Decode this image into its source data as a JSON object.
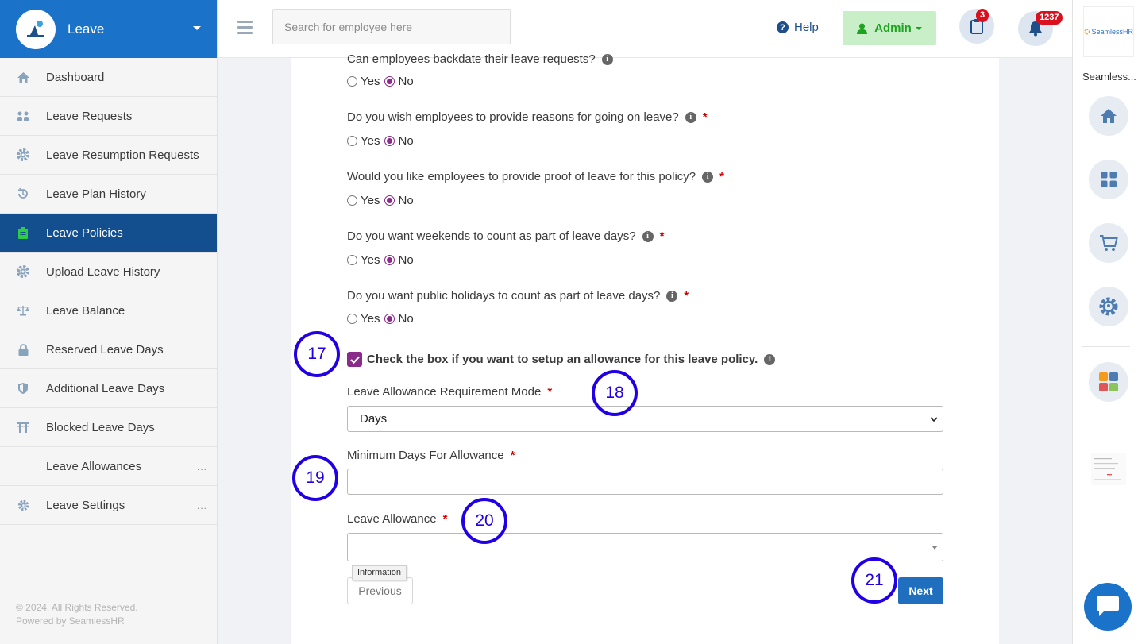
{
  "sidebar": {
    "title": "Leave",
    "items": [
      {
        "label": "Dashboard",
        "icon": "home-icon"
      },
      {
        "label": "Leave Requests",
        "icon": "users-icon"
      },
      {
        "label": "Leave Resumption Requests",
        "icon": "gear-icon"
      },
      {
        "label": "Leave Plan History",
        "icon": "history-icon"
      },
      {
        "label": "Leave Policies",
        "icon": "clipboard-icon",
        "active": true
      },
      {
        "label": "Upload Leave History",
        "icon": "gear-icon"
      },
      {
        "label": "Leave Balance",
        "icon": "scale-icon"
      },
      {
        "label": "Reserved Leave Days",
        "icon": "lock-icon"
      },
      {
        "label": "Additional Leave Days",
        "icon": "shield-icon"
      },
      {
        "label": "Blocked Leave Days",
        "icon": "gate-icon"
      },
      {
        "label": "Leave Allowances",
        "icon": "none",
        "more": "..."
      },
      {
        "label": "Leave Settings",
        "icon": "gear-icon",
        "more": "..."
      }
    ],
    "footer_line1": "© 2024. All Rights Reserved.",
    "footer_line2": "Powered by SeamlessHR"
  },
  "topbar": {
    "search_placeholder": "Search for employee here",
    "help_label": "Help",
    "admin_label": "Admin",
    "clipboard_badge": "3",
    "notification_badge": "1237"
  },
  "rail": {
    "logo_text": "SeamlessHR",
    "company_name": "Seamless..."
  },
  "form": {
    "q_backdate": "Can employees backdate their leave requests?",
    "q_reasons": "Do you wish employees to provide reasons for going on leave?",
    "q_proof": "Would you like employees to provide proof of leave for this policy?",
    "q_weekends": "Do you want weekends to count as part of leave days?",
    "q_holidays": "Do you want public holidays to count as part of leave days?",
    "yes": "Yes",
    "no": "No",
    "required_mark": "*",
    "info_glyph": "i",
    "allowance_checkbox_label": "Check the box if you want to setup an allowance for this leave policy.",
    "mode_label": "Leave Allowance Requirement Mode",
    "mode_value": "Days",
    "min_days_label": "Minimum Days For Allowance",
    "min_days_value": "",
    "allowance_label": "Leave Allowance",
    "tooltip": "Information",
    "previous": "Previous",
    "next": "Next"
  },
  "annotations": [
    "17",
    "18",
    "19",
    "20",
    "21"
  ],
  "colors": {
    "brand_blue": "#1a73c9",
    "active_nav": "#134f8f",
    "radio_purple": "#8a2a8a",
    "annotation": "#2200e6",
    "badge_red": "#d9101d"
  }
}
